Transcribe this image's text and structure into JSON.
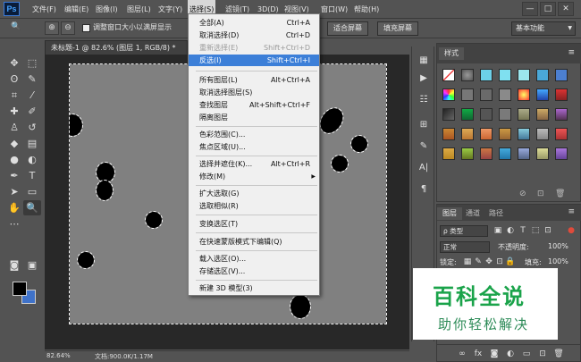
{
  "app": {
    "logo": "Ps"
  },
  "menubar": {
    "items": [
      "文件(F)",
      "编辑(E)",
      "图像(I)",
      "图层(L)",
      "文字(Y)",
      "选择(S)",
      "滤镜(T)",
      "3D(D)",
      "视图(V)",
      "窗口(W)",
      "帮助(H)"
    ],
    "active_index": 5,
    "window_controls": [
      "—",
      "□",
      "✕"
    ]
  },
  "options": {
    "checkbox_label": "调整窗口大小以满屏显示",
    "fit_screen": "适合屏幕",
    "fill_screen": "填充屏幕",
    "workspace": "基本功能"
  },
  "document": {
    "tab_title": "未标题-1 @ 82.6% (图层 1, RGB/8) *",
    "zoom": "82.64%",
    "doc_info": "文档:900.0K/1.17M"
  },
  "select_menu": {
    "items": [
      {
        "label": "全部(A)",
        "shortcut": "Ctrl+A",
        "state": "normal"
      },
      {
        "label": "取消选择(D)",
        "shortcut": "Ctrl+D",
        "state": "normal"
      },
      {
        "label": "重新选择(E)",
        "shortcut": "Shift+Ctrl+D",
        "state": "disabled"
      },
      {
        "label": "反选(I)",
        "shortcut": "Shift+Ctrl+I",
        "state": "highlighted"
      },
      {
        "label": "所有图层(L)",
        "shortcut": "Alt+Ctrl+A",
        "state": "normal"
      },
      {
        "label": "取消选择图层(S)",
        "shortcut": "",
        "state": "normal"
      },
      {
        "label": "查找图层",
        "shortcut": "Alt+Shift+Ctrl+F",
        "state": "normal"
      },
      {
        "label": "隔离图层",
        "shortcut": "",
        "state": "normal"
      },
      {
        "label": "色彩范围(C)...",
        "shortcut": "",
        "state": "normal"
      },
      {
        "label": "焦点区域(U)...",
        "shortcut": "",
        "state": "normal"
      },
      {
        "label": "选择并遮住(K)...",
        "shortcut": "Alt+Ctrl+R",
        "state": "normal"
      },
      {
        "label": "修改(M)",
        "shortcut": "",
        "state": "submenu"
      },
      {
        "label": "扩大选取(G)",
        "shortcut": "",
        "state": "normal"
      },
      {
        "label": "选取相似(R)",
        "shortcut": "",
        "state": "normal"
      },
      {
        "label": "变换选区(T)",
        "shortcut": "",
        "state": "normal"
      },
      {
        "label": "在快速蒙版模式下编辑(Q)",
        "shortcut": "",
        "state": "normal"
      },
      {
        "label": "载入选区(O)...",
        "shortcut": "",
        "state": "normal"
      },
      {
        "label": "存储选区(V)...",
        "shortcut": "",
        "state": "normal"
      },
      {
        "label": "新建 3D 模型(3)",
        "shortcut": "",
        "state": "normal"
      }
    ]
  },
  "styles_panel": {
    "tab": "样式"
  },
  "layers_panel": {
    "tabs": [
      "图层",
      "通道",
      "路径"
    ],
    "filter_kind": "ρ 类型",
    "blend_mode": "正常",
    "opacity_label": "不透明度:",
    "opacity_value": "100%",
    "lock_label": "锁定:",
    "fill_label": "填充:",
    "fill_value": "100%"
  },
  "watermark": {
    "main": "百科全说",
    "sub": "助你轻松解决"
  },
  "colors": {
    "accent": "#3c7fd8",
    "foreground": "#000000",
    "background": "#3f72c9",
    "canvas": "#808080"
  }
}
